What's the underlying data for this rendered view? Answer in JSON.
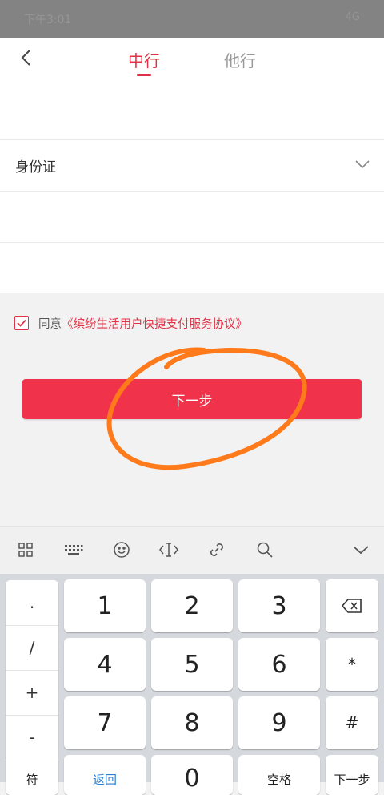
{
  "status_bar": {
    "time": "下午3:01",
    "icons": "4G"
  },
  "nav": {
    "tab_active": "中行",
    "tab_other": "他行",
    "accent": "#e03347"
  },
  "form": {
    "id_type_label": "身份证"
  },
  "agreement": {
    "prefix": "同意",
    "link": "《缤纷生活用户快捷支付服务协议》",
    "checked": true
  },
  "next_button": {
    "label": "下一步",
    "color": "#f0334a"
  },
  "keyboard_toolbar": {
    "icons": [
      "grid-icon",
      "keyboard-icon",
      "emoji-icon",
      "cursor-icon",
      "link-icon",
      "search-icon",
      "chevron-down-icon"
    ]
  },
  "keyboard": {
    "symbols": [
      ".",
      "/",
      "+",
      "-"
    ],
    "digits": [
      "1",
      "2",
      "3",
      "4",
      "5",
      "6",
      "7",
      "8",
      "9",
      "0"
    ],
    "star": "*",
    "hash": "#",
    "bottom": {
      "sym": "符",
      "back": "返回",
      "space": "空格",
      "next": "下一步"
    }
  }
}
